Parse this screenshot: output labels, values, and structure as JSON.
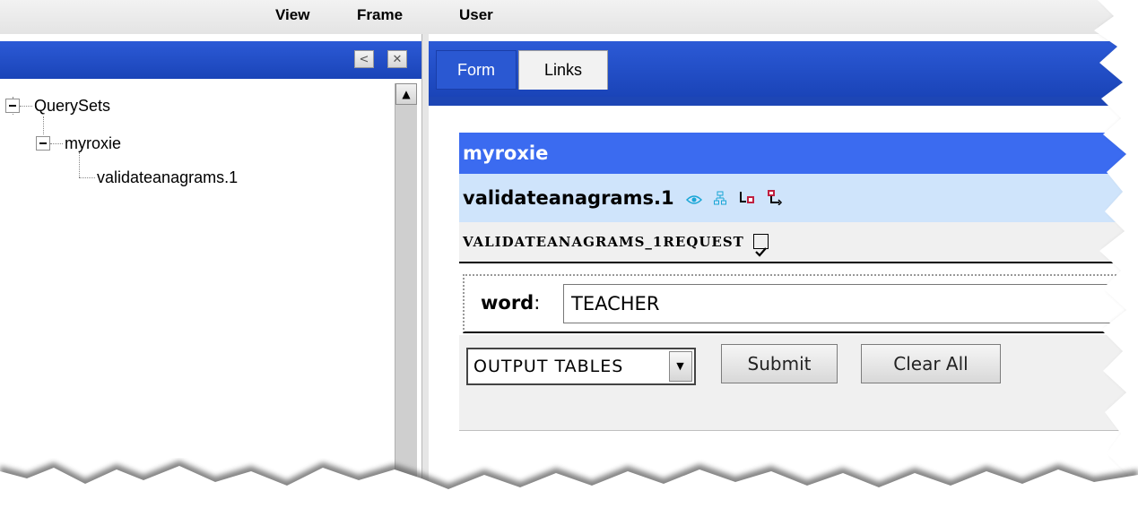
{
  "menubar": {
    "items": [
      "View",
      "Frame",
      "User"
    ]
  },
  "left_panel": {
    "header_buttons": {
      "collapse": "<",
      "close": "✕"
    },
    "tree": {
      "root": "QuerySets",
      "child": "myroxie",
      "leaf": "validateanagrams.1"
    }
  },
  "right_panel": {
    "tabs": [
      "Form",
      "Links"
    ],
    "form": {
      "title": "myroxie",
      "query_name": "validateanagrams.1",
      "request_label": "VALIDATEANAGRAMS_1REQUEST",
      "request_checked": true,
      "field_label": "word",
      "field_value": "TEACHER",
      "output_select": "OUTPUT TABLES",
      "submit_label": "Submit",
      "clear_label": "Clear All"
    }
  },
  "icons": {
    "eye": "eye-icon",
    "tree": "hierarchy-icon",
    "flow1": "flow-in-icon",
    "flow2": "flow-out-icon"
  },
  "colors": {
    "header_blue": "#2c5ad6",
    "title_blue": "#3b6bf0",
    "sub_light_blue": "#cfe4fb"
  }
}
